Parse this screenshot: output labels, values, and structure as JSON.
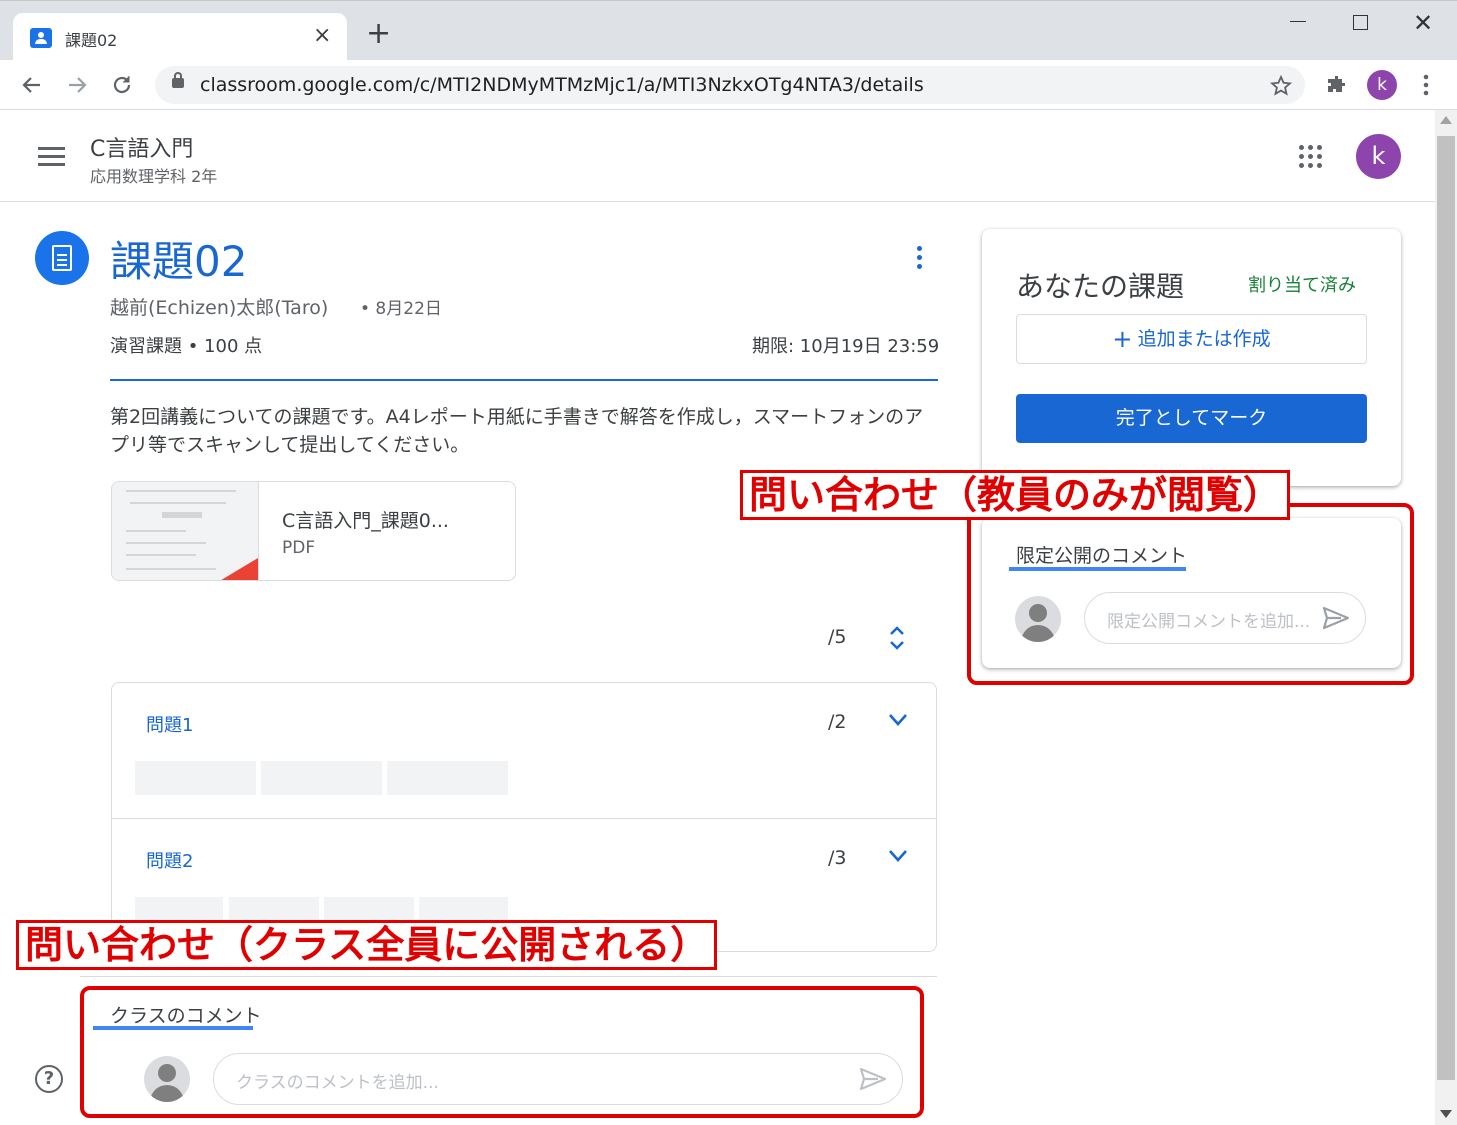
{
  "browser": {
    "tab_title": "課題02",
    "tab_close": "×",
    "new_tab": "+",
    "url": "classroom.google.com/c/MTI2NDMyMTMzMjc1/a/MTI3NzkxOTg4NTA3/details",
    "profile_initial": "k",
    "close_glyph": "✕"
  },
  "header": {
    "course_title": "C言語入門",
    "course_section": "応用数理学科 2年",
    "profile_initial": "k"
  },
  "assignment": {
    "title": "課題02",
    "author": "越前(Echizen)太郎(Taro)",
    "date": "• 8月22日",
    "type_points": "演習課題 • 100 点",
    "due": "期限: 10月19日 23:59",
    "description": "第2回講義についての課題です。A4レポート用紙に手書きで解答を作成し，スマートフォンのアプリ等でスキャンして提出してください。",
    "attachment": {
      "name": "C言語入門_課題0...",
      "type": "PDF"
    },
    "total_score": "/5",
    "questions": [
      {
        "label": "問題1",
        "score": "/2"
      },
      {
        "label": "問題2",
        "score": "/3"
      }
    ]
  },
  "class_comments": {
    "title": "クラスのコメント",
    "placeholder": "クラスのコメントを追加..."
  },
  "your_work": {
    "title": "あなたの課題",
    "status": "割り当て済み",
    "add_label": "追加または作成",
    "mark_done_label": "完了としてマーク"
  },
  "private_comments": {
    "title": "限定公開のコメント",
    "placeholder": "限定公開コメントを追加..."
  },
  "annotations": {
    "private_label": "問い合わせ（教員のみが閲覧）",
    "class_label": "問い合わせ（クラス全員に公開される）"
  },
  "colors": {
    "accent": "#1967d2",
    "status_green": "#188038",
    "annotation_red": "#e00000",
    "avatar_purple": "#8e44ad"
  },
  "icons": [
    "back-arrow-icon",
    "forward-arrow-icon",
    "reload-icon",
    "lock-icon",
    "star-icon",
    "extensions-icon",
    "more-vert-icon",
    "menu-icon",
    "apps-grid-icon",
    "assignment-icon",
    "chevron-down-icon",
    "expand-collapse-icon",
    "send-icon",
    "help-icon",
    "plus-icon"
  ]
}
